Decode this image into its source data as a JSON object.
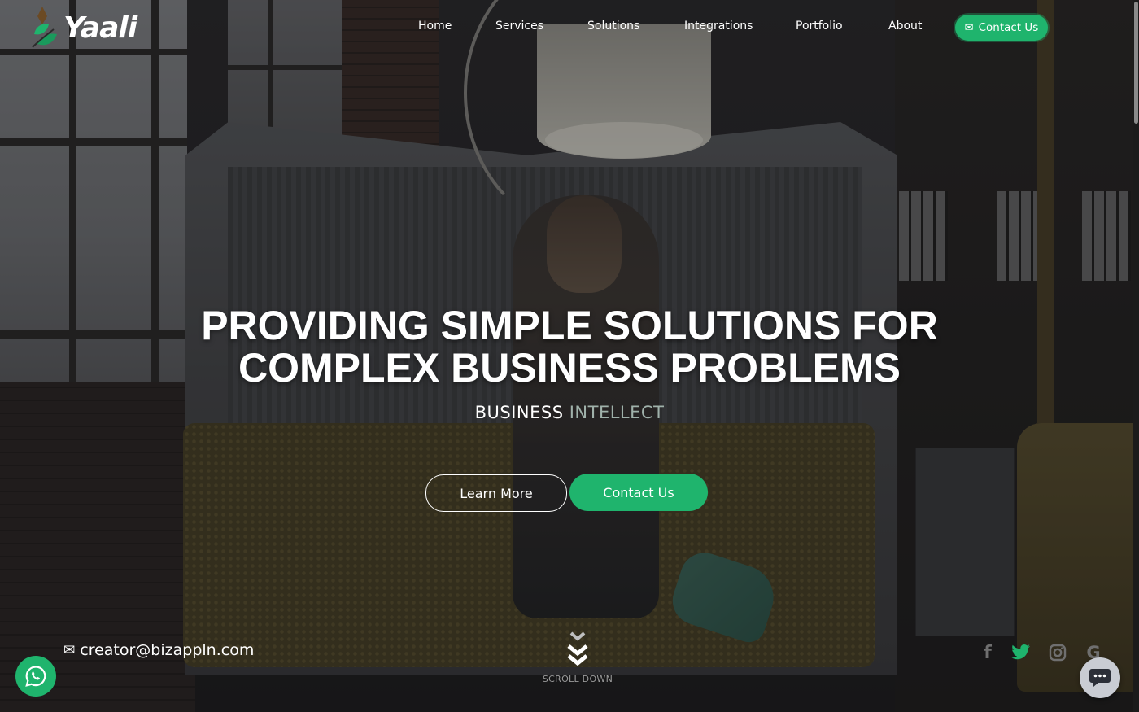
{
  "brand": {
    "name": "Yaali",
    "logo_icon": "leaf-drop-logo-icon"
  },
  "nav": {
    "items": [
      {
        "label": "Home"
      },
      {
        "label": "Services"
      },
      {
        "label": "Solutions"
      },
      {
        "label": "Integrations"
      },
      {
        "label": "Portfolio"
      },
      {
        "label": "About"
      }
    ],
    "contact_label": "Contact Us",
    "contact_icon": "envelope-icon"
  },
  "hero": {
    "title_line1": "PROVIDING SIMPLE SOLUTIONS FOR",
    "title_line2": "COMPLEX BUSINESS PROBLEMS",
    "subtitle_word1": "BUSINESS",
    "subtitle_word2": "INTELLECT",
    "learn_more_label": "Learn More",
    "contact_label": "Contact Us"
  },
  "footer": {
    "email": "creator@bizappln.com",
    "email_icon": "envelope-icon",
    "scroll_label": "SCROLL DOWN",
    "social": [
      {
        "name": "facebook-icon",
        "glyph": "f",
        "color": "#6f6f6f"
      },
      {
        "name": "twitter-icon",
        "glyph": "",
        "color": "#1fb46d"
      },
      {
        "name": "instagram-icon",
        "glyph": "",
        "color": "#6f6f6f"
      },
      {
        "name": "google-icon",
        "glyph": "G",
        "color": "#6f6f6f"
      }
    ]
  },
  "colors": {
    "accent": "#1fb46d",
    "subtitle_muted": "#9fb1aa",
    "overlay": "#0c0c10",
    "chat_bubble": "#c9ccd3"
  }
}
